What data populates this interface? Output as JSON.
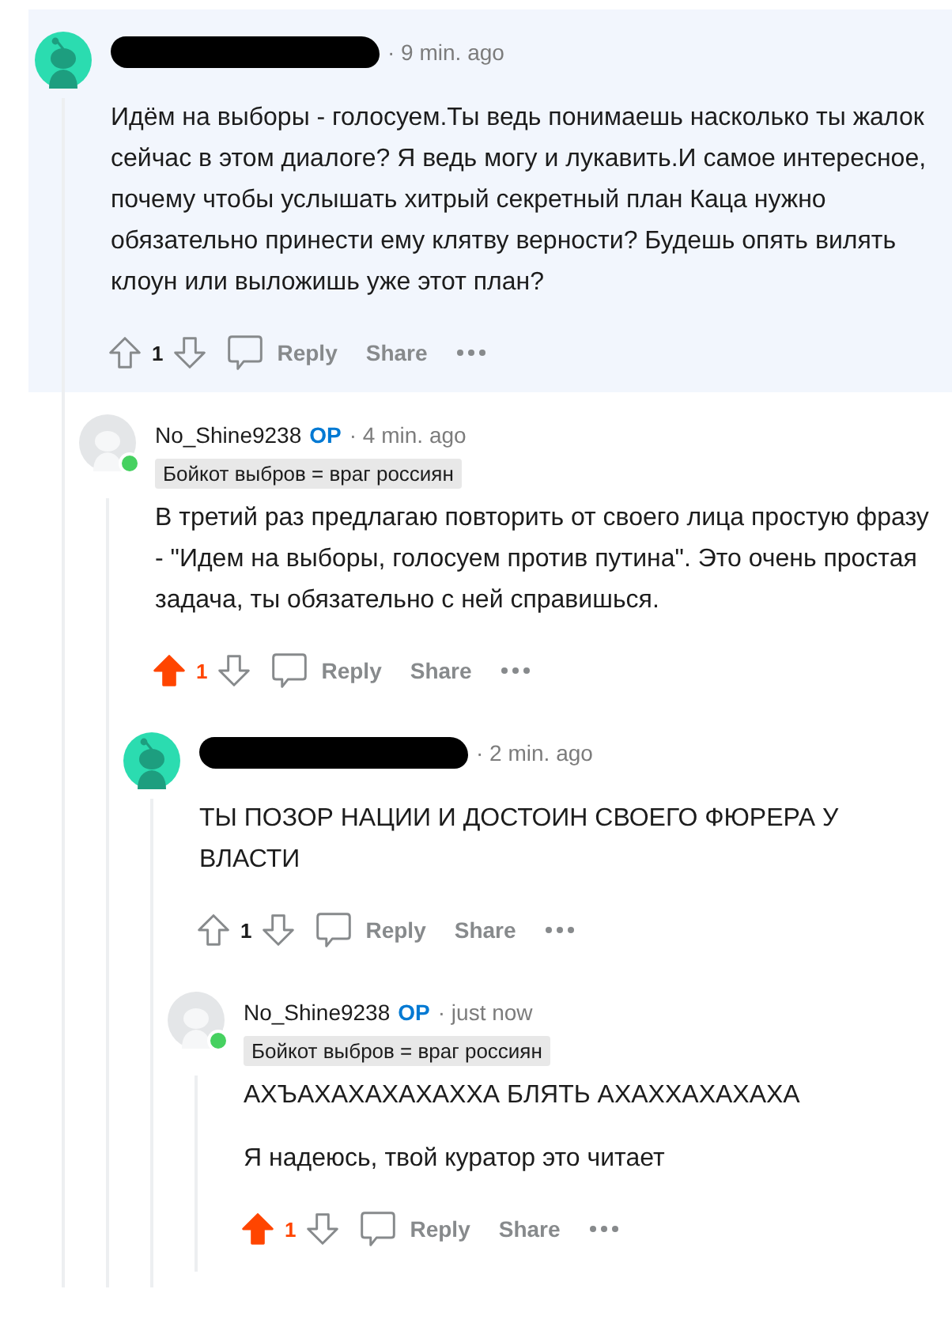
{
  "comments": [
    {
      "author_redacted": true,
      "kind": "custom",
      "online": false,
      "highlighted": true,
      "time": "· 9 min. ago",
      "body": [
        "Идём на выборы - голосуем.Ты ведь понимаешь насколько ты жалок сейчас в этом диалоге? Я ведь могу и лукавить.И самое интересное, почему чтобы услышать хитрый секретный план Каца нужно обязательно принести ему клятву верности? Будешь опять вилять клоун или выложишь уже этот план?"
      ],
      "upvoted": false,
      "score": "1",
      "actions": [
        "Reply",
        "Share"
      ],
      "children": [
        {
          "author": "No_Shine9238",
          "op": "OP",
          "kind": "default",
          "online": true,
          "highlighted": false,
          "time": "· 4 min. ago",
          "flair": "Бойкот выбров = враг россиян",
          "body": [
            "В третий раз предлагаю повторить от своего лица простую фразу - \"Идем на выборы, голосуем против путина\". Это очень простая задача, ты обязательно с ней справишься."
          ],
          "upvoted": true,
          "score": "1",
          "actions": [
            "Reply",
            "Share"
          ],
          "children": [
            {
              "author_redacted": true,
              "kind": "custom",
              "online": false,
              "highlighted": false,
              "time": "· 2 min. ago",
              "body": [
                "ТЫ ПОЗОР НАЦИИ И ДОСТОИН СВОЕГО ФЮРЕРА У ВЛАСТИ"
              ],
              "upvoted": false,
              "score": "1",
              "actions": [
                "Reply",
                "Share"
              ],
              "children": [
                {
                  "author": "No_Shine9238",
                  "op": "OP",
                  "kind": "default",
                  "online": true,
                  "highlighted": false,
                  "time": "· just now",
                  "flair": "Бойкот выбров = враг россиян",
                  "body": [
                    "АХЪАХАХАХАХАХХА БЛЯТЬ АХАХХАХАХАХА",
                    "Я надеюсь, твой куратор это читает"
                  ],
                  "upvoted": true,
                  "score": "1",
                  "actions": [
                    "Reply",
                    "Share"
                  ]
                }
              ]
            }
          ]
        }
      ]
    }
  ]
}
